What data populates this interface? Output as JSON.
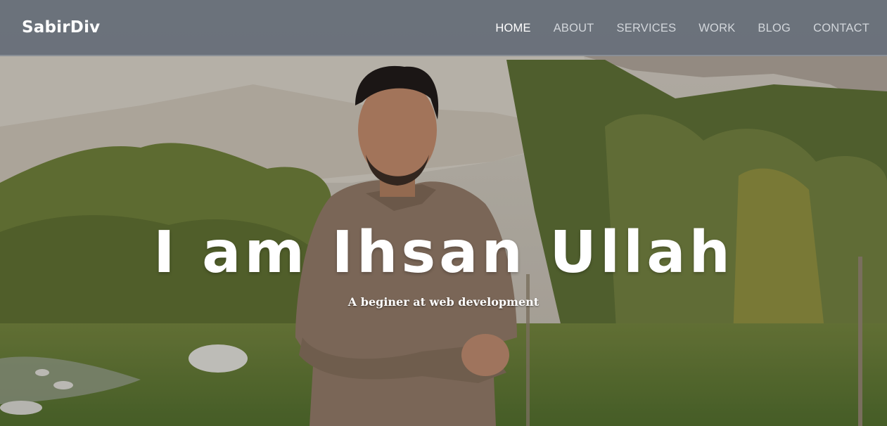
{
  "brand": {
    "name": "SabirDiv"
  },
  "nav": {
    "items": [
      {
        "label": "HOME",
        "active": true
      },
      {
        "label": "ABOUT",
        "active": false
      },
      {
        "label": "SERVICES",
        "active": false
      },
      {
        "label": "WORK",
        "active": false
      },
      {
        "label": "BLOG",
        "active": false
      },
      {
        "label": "CONTACT",
        "active": false
      }
    ]
  },
  "hero": {
    "title": "I am Ihsan Ullah",
    "subtitle": "A beginer at web development",
    "background_image": "portrait-outdoors-photo"
  },
  "colors": {
    "navbar": "#68707a",
    "nav_text": "#d2d6db",
    "nav_active": "#ffffff",
    "hero_text": "#ffffff"
  }
}
